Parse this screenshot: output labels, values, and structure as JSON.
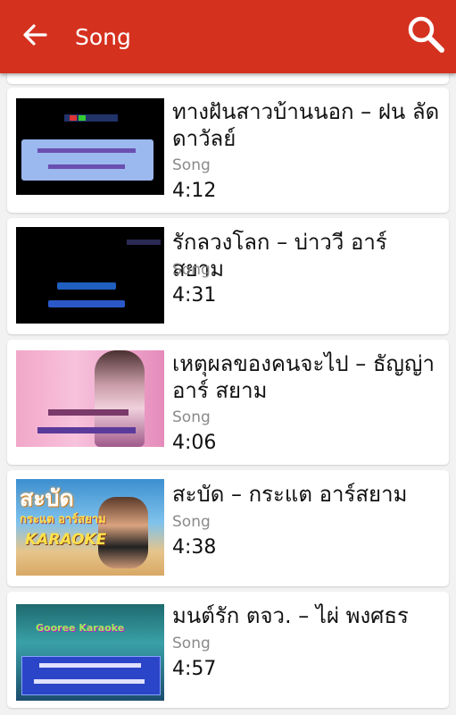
{
  "appbar": {
    "title": "Song",
    "back_icon": "arrow-left-icon",
    "search_icon": "search-icon",
    "color": "#d5311f"
  },
  "songs": [
    {
      "title": "ทางฝันสาวบ้านนอก – ฝน ลัดดาวัลย์",
      "type": "Song",
      "duration": "4:12"
    },
    {
      "title": "รักลวงโลก – บ่าววี อาร์ สยาม",
      "type": "Song",
      "duration": "4:31"
    },
    {
      "title": "เหตุผลของคนจะไป – ธัญญ่า อาร์ สยาม",
      "type": "Song",
      "duration": "4:06"
    },
    {
      "title": "สะบัด – กระแต อาร์สยาม",
      "type": "Song",
      "duration": "4:38"
    },
    {
      "title": "มนต์รัก ตจว. – ไผ่ พงศธร",
      "type": "Song",
      "duration": "4:57"
    }
  ],
  "thumbnails": {
    "t4_title": "สะบัด",
    "t4_artist": "กระแต อาร์สยาม",
    "t4_karaoke": "KARAOKE",
    "t5_banner": "Gooree Karaoke"
  }
}
